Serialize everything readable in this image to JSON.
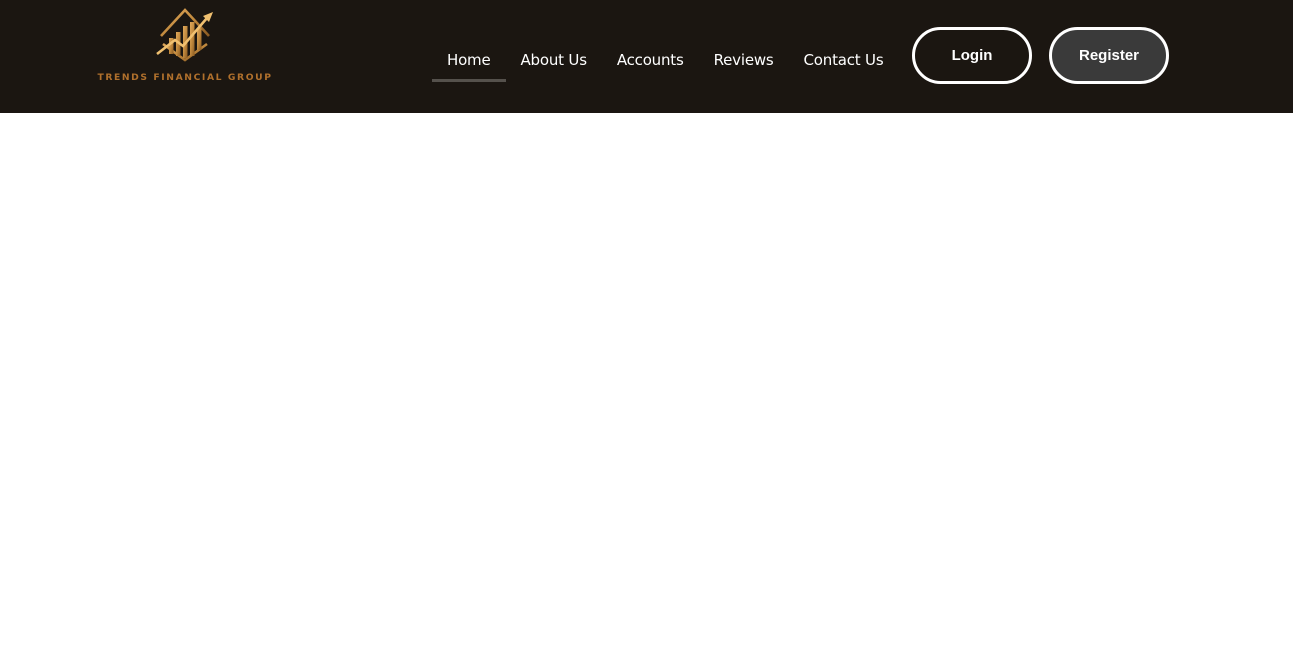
{
  "brand": {
    "name": "TRENDS FINANCIAL GROUP",
    "logo_icon": "bar-chart-arrow-icon",
    "accent_color": "#c28a3e"
  },
  "nav": {
    "items": [
      {
        "label": "Home",
        "active": true
      },
      {
        "label": "About Us",
        "active": false
      },
      {
        "label": "Accounts",
        "active": false
      },
      {
        "label": "Reviews",
        "active": false
      },
      {
        "label": "Contact Us",
        "active": false
      }
    ]
  },
  "auth": {
    "login_label": "Login",
    "register_label": "Register"
  },
  "colors": {
    "header_bg": "#1b1611",
    "register_bg": "#3a3a3a",
    "active_underline": "#55514c"
  }
}
